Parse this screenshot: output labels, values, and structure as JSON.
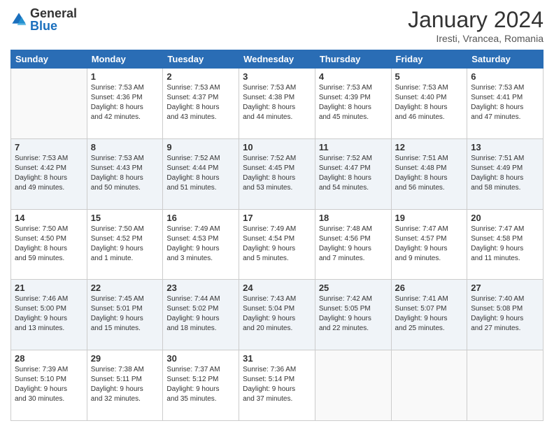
{
  "header": {
    "logo": {
      "general": "General",
      "blue": "Blue"
    },
    "title": "January 2024",
    "subtitle": "Iresti, Vrancea, Romania"
  },
  "days_of_week": [
    "Sunday",
    "Monday",
    "Tuesday",
    "Wednesday",
    "Thursday",
    "Friday",
    "Saturday"
  ],
  "weeks": [
    [
      {
        "day": "",
        "text": ""
      },
      {
        "day": "1",
        "text": "Sunrise: 7:53 AM\nSunset: 4:36 PM\nDaylight: 8 hours\nand 42 minutes."
      },
      {
        "day": "2",
        "text": "Sunrise: 7:53 AM\nSunset: 4:37 PM\nDaylight: 8 hours\nand 43 minutes."
      },
      {
        "day": "3",
        "text": "Sunrise: 7:53 AM\nSunset: 4:38 PM\nDaylight: 8 hours\nand 44 minutes."
      },
      {
        "day": "4",
        "text": "Sunrise: 7:53 AM\nSunset: 4:39 PM\nDaylight: 8 hours\nand 45 minutes."
      },
      {
        "day": "5",
        "text": "Sunrise: 7:53 AM\nSunset: 4:40 PM\nDaylight: 8 hours\nand 46 minutes."
      },
      {
        "day": "6",
        "text": "Sunrise: 7:53 AM\nSunset: 4:41 PM\nDaylight: 8 hours\nand 47 minutes."
      }
    ],
    [
      {
        "day": "7",
        "text": "Sunrise: 7:53 AM\nSunset: 4:42 PM\nDaylight: 8 hours\nand 49 minutes."
      },
      {
        "day": "8",
        "text": "Sunrise: 7:53 AM\nSunset: 4:43 PM\nDaylight: 8 hours\nand 50 minutes."
      },
      {
        "day": "9",
        "text": "Sunrise: 7:52 AM\nSunset: 4:44 PM\nDaylight: 8 hours\nand 51 minutes."
      },
      {
        "day": "10",
        "text": "Sunrise: 7:52 AM\nSunset: 4:45 PM\nDaylight: 8 hours\nand 53 minutes."
      },
      {
        "day": "11",
        "text": "Sunrise: 7:52 AM\nSunset: 4:47 PM\nDaylight: 8 hours\nand 54 minutes."
      },
      {
        "day": "12",
        "text": "Sunrise: 7:51 AM\nSunset: 4:48 PM\nDaylight: 8 hours\nand 56 minutes."
      },
      {
        "day": "13",
        "text": "Sunrise: 7:51 AM\nSunset: 4:49 PM\nDaylight: 8 hours\nand 58 minutes."
      }
    ],
    [
      {
        "day": "14",
        "text": "Sunrise: 7:50 AM\nSunset: 4:50 PM\nDaylight: 8 hours\nand 59 minutes."
      },
      {
        "day": "15",
        "text": "Sunrise: 7:50 AM\nSunset: 4:52 PM\nDaylight: 9 hours\nand 1 minute."
      },
      {
        "day": "16",
        "text": "Sunrise: 7:49 AM\nSunset: 4:53 PM\nDaylight: 9 hours\nand 3 minutes."
      },
      {
        "day": "17",
        "text": "Sunrise: 7:49 AM\nSunset: 4:54 PM\nDaylight: 9 hours\nand 5 minutes."
      },
      {
        "day": "18",
        "text": "Sunrise: 7:48 AM\nSunset: 4:56 PM\nDaylight: 9 hours\nand 7 minutes."
      },
      {
        "day": "19",
        "text": "Sunrise: 7:47 AM\nSunset: 4:57 PM\nDaylight: 9 hours\nand 9 minutes."
      },
      {
        "day": "20",
        "text": "Sunrise: 7:47 AM\nSunset: 4:58 PM\nDaylight: 9 hours\nand 11 minutes."
      }
    ],
    [
      {
        "day": "21",
        "text": "Sunrise: 7:46 AM\nSunset: 5:00 PM\nDaylight: 9 hours\nand 13 minutes."
      },
      {
        "day": "22",
        "text": "Sunrise: 7:45 AM\nSunset: 5:01 PM\nDaylight: 9 hours\nand 15 minutes."
      },
      {
        "day": "23",
        "text": "Sunrise: 7:44 AM\nSunset: 5:02 PM\nDaylight: 9 hours\nand 18 minutes."
      },
      {
        "day": "24",
        "text": "Sunrise: 7:43 AM\nSunset: 5:04 PM\nDaylight: 9 hours\nand 20 minutes."
      },
      {
        "day": "25",
        "text": "Sunrise: 7:42 AM\nSunset: 5:05 PM\nDaylight: 9 hours\nand 22 minutes."
      },
      {
        "day": "26",
        "text": "Sunrise: 7:41 AM\nSunset: 5:07 PM\nDaylight: 9 hours\nand 25 minutes."
      },
      {
        "day": "27",
        "text": "Sunrise: 7:40 AM\nSunset: 5:08 PM\nDaylight: 9 hours\nand 27 minutes."
      }
    ],
    [
      {
        "day": "28",
        "text": "Sunrise: 7:39 AM\nSunset: 5:10 PM\nDaylight: 9 hours\nand 30 minutes."
      },
      {
        "day": "29",
        "text": "Sunrise: 7:38 AM\nSunset: 5:11 PM\nDaylight: 9 hours\nand 32 minutes."
      },
      {
        "day": "30",
        "text": "Sunrise: 7:37 AM\nSunset: 5:12 PM\nDaylight: 9 hours\nand 35 minutes."
      },
      {
        "day": "31",
        "text": "Sunrise: 7:36 AM\nSunset: 5:14 PM\nDaylight: 9 hours\nand 37 minutes."
      },
      {
        "day": "",
        "text": ""
      },
      {
        "day": "",
        "text": ""
      },
      {
        "day": "",
        "text": ""
      }
    ]
  ]
}
